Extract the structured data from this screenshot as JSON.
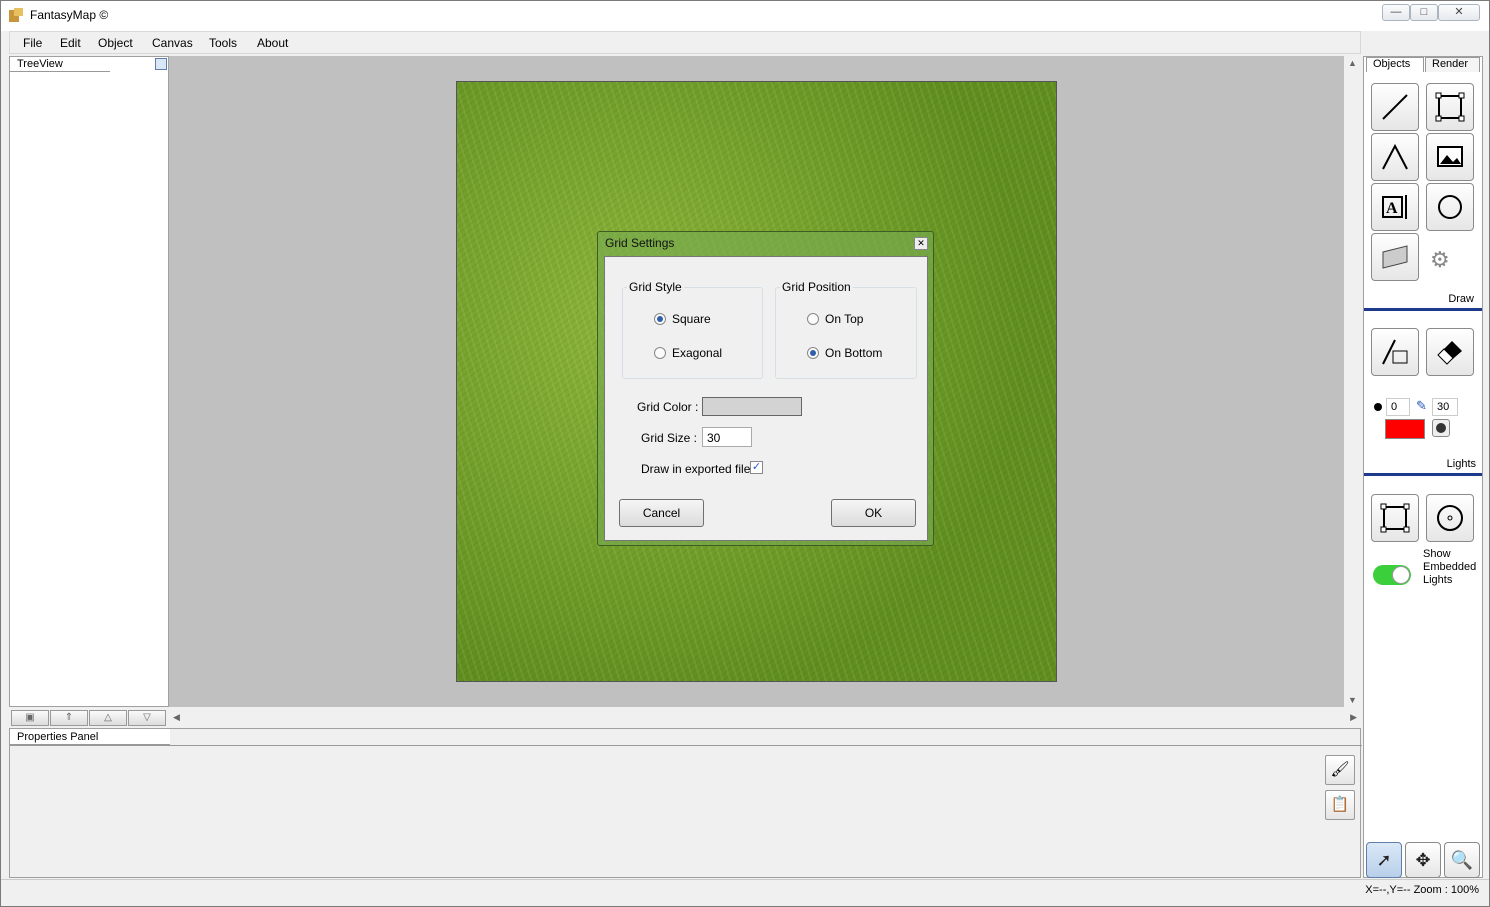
{
  "window": {
    "title": "FantasyMap ©",
    "minimize_glyph": "—",
    "maximize_glyph": "□",
    "close_glyph": "✕"
  },
  "menu": [
    "File",
    "Edit",
    "Object",
    "Canvas",
    "Tools",
    "About"
  ],
  "treeview": {
    "tab_label": "TreeView"
  },
  "properties": {
    "tab_label": "Properties Panel"
  },
  "right_panel": {
    "tabs": [
      "Objects",
      "Render"
    ],
    "draw_label": "Draw",
    "lights_label": "Lights",
    "brush_size": "0",
    "brush_opacity": "30",
    "brush_color": "#ff0000",
    "show_embedded_label": [
      "Show",
      "Embedded",
      "Lights"
    ],
    "toggle_color": "#3ccf3c"
  },
  "status": {
    "text": "X=--,Y=--   Zoom : 100%"
  },
  "dialog": {
    "title": "Grid Settings",
    "grid_style_label": "Grid Style",
    "style_options": [
      "Square",
      "Exagonal"
    ],
    "style_selected": "Square",
    "grid_position_label": "Grid Position",
    "position_options": [
      "On Top",
      "On Bottom"
    ],
    "position_selected": "On Bottom",
    "grid_color_label": "Grid Color :",
    "grid_color_value": "#d3d3d3",
    "grid_size_label": "Grid Size :",
    "grid_size_value": "30",
    "draw_exported_label": "Draw in exported files",
    "draw_exported_checked": true,
    "cancel_label": "Cancel",
    "ok_label": "OK"
  }
}
